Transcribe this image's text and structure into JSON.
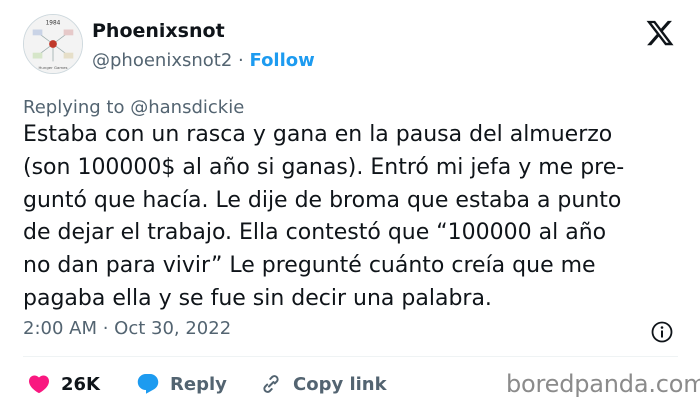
{
  "author": {
    "name": "Phoenixsnot",
    "handle": "@phoenixsnot2",
    "separator": "·",
    "follow_label": "Follow",
    "avatar_labels": [
      "1984",
      "Hunger Games"
    ]
  },
  "reply": {
    "prefix": "Replying to",
    "mention": "@hansdickie"
  },
  "tweet": {
    "lines": [
      "Estaba con un rasca y gana en la pausa del almuerzo",
      "(son 100000$ al año si ganas). Entró mi jefa y me pre-",
      "guntó que hacía. Le dije de broma que estaba a punto",
      "de dejar el trabajo. Ella contestó que “100000 al año",
      "no dan para vivir” Le pregunté cuánto creía que me",
      "pagaba ella y se fue sin decir una palabra."
    ],
    "timestamp": "2:00 AM · Oct 30, 2022"
  },
  "actions": {
    "like_count": "26K",
    "reply_label": "Reply",
    "copy_label": "Copy link"
  },
  "watermark": "boredpanda.com",
  "colors": {
    "text": "#0f1419",
    "muted": "#536471",
    "accent": "#1d9bf0",
    "like": "#f91880",
    "divider": "#eff3f4"
  },
  "icons": {
    "brand": "x-logo-icon",
    "info": "info-icon",
    "like": "heart-icon",
    "reply": "reply-bubble-icon",
    "copy": "link-icon"
  }
}
